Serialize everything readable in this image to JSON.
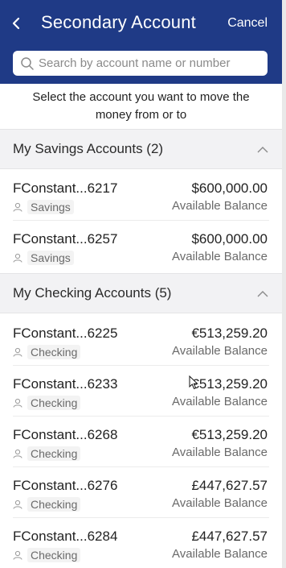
{
  "header": {
    "back_glyph": "<",
    "title": "Secondary Account",
    "cancel_label": "Cancel",
    "background_color": "#1f3a86"
  },
  "search": {
    "placeholder": "Search by account name or number",
    "icon": "search-icon"
  },
  "instruction": "Select the account you want to move the money from or to",
  "sections": [
    {
      "title": "My Savings Accounts (2)",
      "expanded": true,
      "accounts": [
        {
          "name": "FConstant...6217",
          "type": "Savings",
          "balance": "$600,000.00",
          "balance_label": "Available Balance"
        },
        {
          "name": "FConstant...6257",
          "type": "Savings",
          "balance": "$600,000.00",
          "balance_label": "Available Balance"
        }
      ]
    },
    {
      "title": "My Checking Accounts (5)",
      "expanded": true,
      "accounts": [
        {
          "name": "FConstant...6225",
          "type": "Checking",
          "balance": "€513,259.20",
          "balance_label": "Available Balance"
        },
        {
          "name": "FConstant...6233",
          "type": "Checking",
          "balance": "€513,259.20",
          "balance_label": "Available Balance"
        },
        {
          "name": "FConstant...6268",
          "type": "Checking",
          "balance": "€513,259.20",
          "balance_label": "Available Balance"
        },
        {
          "name": "FConstant...6276",
          "type": "Checking",
          "balance": "£447,627.57",
          "balance_label": "Available Balance"
        },
        {
          "name": "FConstant...6284",
          "type": "Checking",
          "balance": "£447,627.57",
          "balance_label": "Available Balance"
        }
      ]
    }
  ]
}
